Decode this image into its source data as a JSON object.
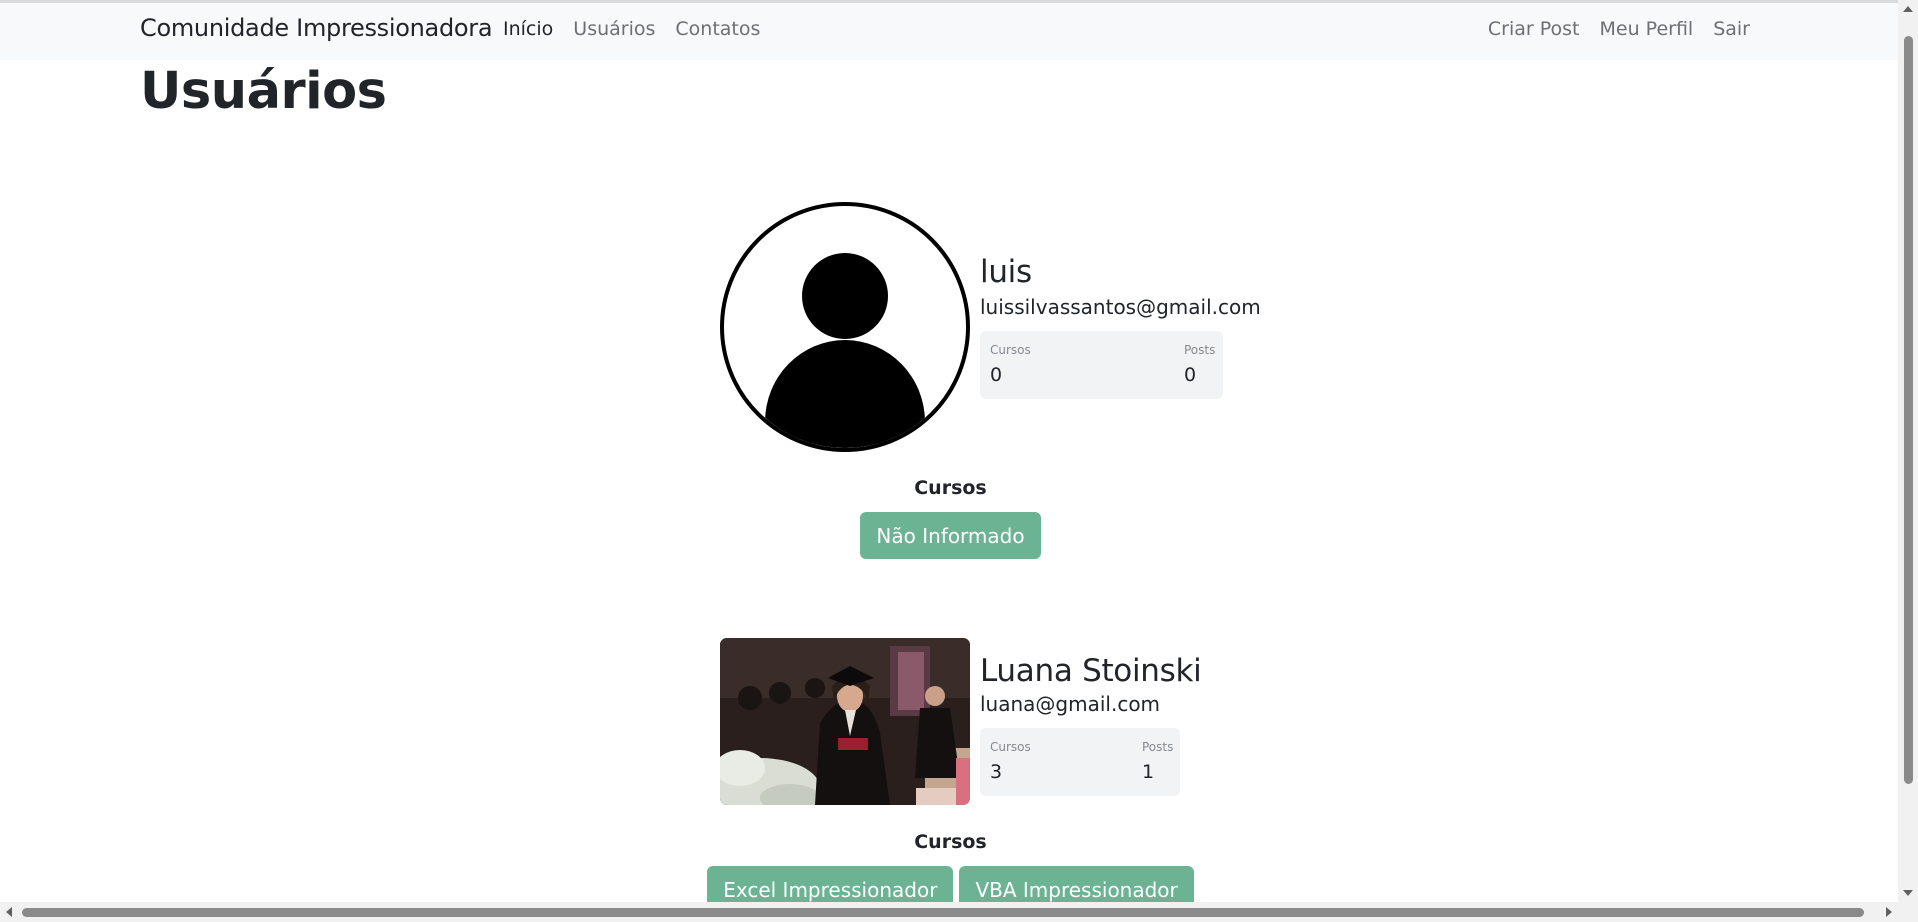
{
  "navbar": {
    "brand": "Comunidade Impressionadora",
    "left_links": [
      "Início",
      "Usuários",
      "Contatos"
    ],
    "right_links": [
      "Criar Post",
      "Meu Perfil",
      "Sair"
    ]
  },
  "page": {
    "title": "Usuários"
  },
  "users": [
    {
      "name": "luis",
      "email": "luissilvassantos@gmail.com",
      "avatar": "default-user-icon",
      "stats": {
        "cursos_label": "Cursos",
        "cursos_value": "0",
        "posts_label": "Posts",
        "posts_value": "0"
      },
      "cursos_title": "Cursos",
      "courses": [
        "Não Informado"
      ]
    },
    {
      "name": "Luana Stoinski",
      "email": "luana@gmail.com",
      "avatar": "graduation-photo",
      "stats": {
        "cursos_label": "Cursos",
        "cursos_value": "3",
        "posts_label": "Posts",
        "posts_value": "1"
      },
      "cursos_title": "Cursos",
      "courses": [
        "Excel Impressionador",
        "VBA Impressionador"
      ]
    }
  ],
  "colors": {
    "course_button": "#6bb393",
    "navbar_bg": "#f8f9fa",
    "stats_bg": "#f1f3f5"
  }
}
